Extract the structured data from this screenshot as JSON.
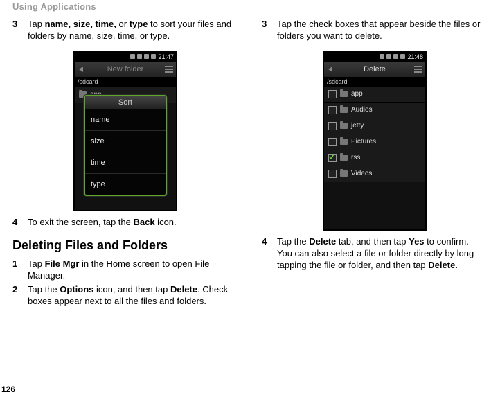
{
  "header": {
    "title": "Using Applications"
  },
  "page_number": "126",
  "col_left": {
    "step3_num": "3",
    "step3_text_pre": "Tap ",
    "step3_bold1": "name, size, time,",
    "step3_mid": " or ",
    "step3_bold2": "type",
    "step3_text_post": " to sort your files and folders by name, size, time, or type.",
    "step4_num": "4",
    "step4_text_pre": "To exit the screen, tap the ",
    "step4_bold": "Back",
    "step4_text_post": " icon.",
    "heading": "Deleting Files and Folders",
    "step1_num": "1",
    "step1_text_pre": "Tap ",
    "step1_bold": "File Mgr",
    "step1_text_post": " in the Home screen to open File Manager.",
    "step2_num": "2",
    "step2_text_pre": "Tap the ",
    "step2_bold1": "Options",
    "step2_mid": " icon, and then tap ",
    "step2_bold2": "Delete",
    "step2_text_post": ". Check boxes appear next to all the files and folders."
  },
  "col_right": {
    "step3_num": "3",
    "step3_text": "Tap the check boxes that appear beside the files or folders you want to delete.",
    "step4_num": "4",
    "step4_text_pre": "Tap the ",
    "step4_bold1": "Delete",
    "step4_mid": " tab, and then tap ",
    "step4_bold2": "Yes",
    "step4_post1": " to confirm.",
    "step4_line2_pre": "You can also select a file or folder directly by long tapping the file or folder, and then tap ",
    "step4_bold3": "Delete",
    "step4_line2_post": "."
  },
  "phone_sort": {
    "time": "21:47",
    "title": "New folder",
    "path": "/sdcard",
    "row": "app",
    "popup_title": "Sort",
    "items": [
      "name",
      "size",
      "time",
      "type"
    ]
  },
  "phone_delete": {
    "time": "21:48",
    "title": "Delete",
    "path": "/sdcard",
    "rows": [
      {
        "label": "app",
        "checked": false
      },
      {
        "label": "Audios",
        "checked": false
      },
      {
        "label": "jetty",
        "checked": false
      },
      {
        "label": "Pictures",
        "checked": false
      },
      {
        "label": "rss",
        "checked": true
      },
      {
        "label": "Videos",
        "checked": false
      }
    ]
  }
}
